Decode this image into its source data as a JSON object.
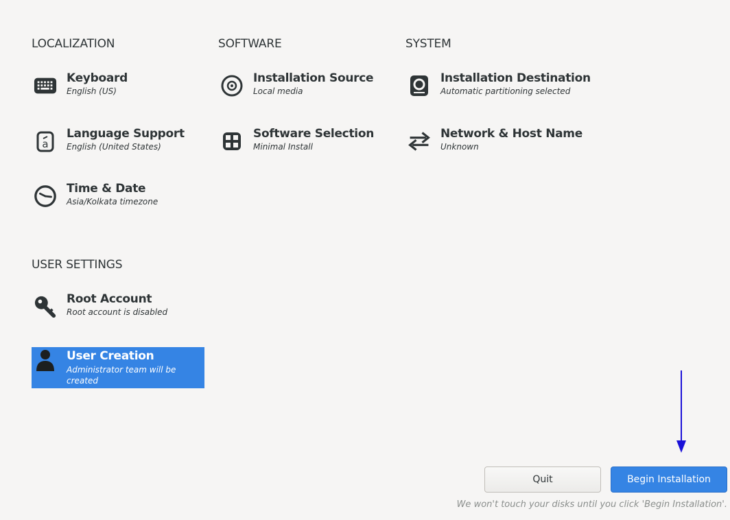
{
  "sections": {
    "localization": "LOCALIZATION",
    "software": "SOFTWARE",
    "system": "SYSTEM",
    "user_settings": "USER SETTINGS"
  },
  "spokes": {
    "keyboard": {
      "label": "Keyboard",
      "status": "English (US)",
      "icon": "keyboard-icon"
    },
    "language": {
      "label": "Language Support",
      "status": "English (United States)",
      "icon": "language-icon"
    },
    "time": {
      "label": "Time & Date",
      "status": "Asia/Kolkata timezone",
      "icon": "clock-icon"
    },
    "source": {
      "label": "Installation Source",
      "status": "Local media",
      "icon": "disc-icon"
    },
    "selection": {
      "label": "Software Selection",
      "status": "Minimal Install",
      "icon": "package-icon"
    },
    "destination": {
      "label": "Installation Destination",
      "status": "Automatic partitioning selected",
      "icon": "disk-icon"
    },
    "network": {
      "label": "Network & Host Name",
      "status": "Unknown",
      "icon": "network-arrows-icon"
    },
    "root": {
      "label": "Root Account",
      "status": "Root account is disabled",
      "icon": "key-icon"
    },
    "user": {
      "label": "User Creation",
      "status": "Administrator team will be created",
      "icon": "user-icon"
    }
  },
  "buttons": {
    "quit": "Quit",
    "begin": "Begin Installation"
  },
  "footer_note": "We won't touch your disks until you click 'Begin Installation'.",
  "colors": {
    "accent": "#3584e4",
    "background": "#f6f5f4",
    "annotation_arrow": "#1a10d8"
  }
}
